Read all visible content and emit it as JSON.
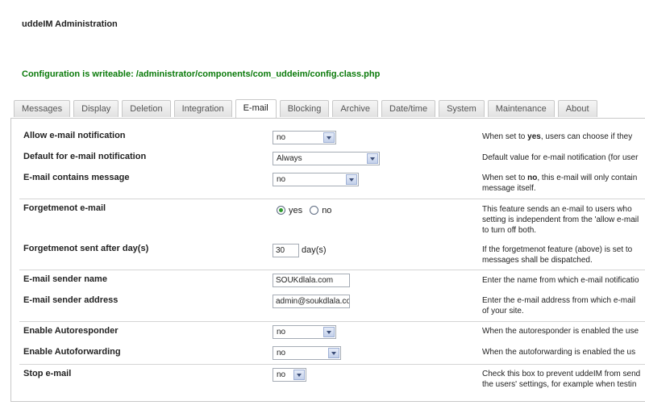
{
  "header": {
    "title": "uddeIM Administration",
    "status": "Configuration is writeable: /administrator/components/com_uddeim/config.class.php"
  },
  "tabs": [
    {
      "label": "Messages"
    },
    {
      "label": "Display"
    },
    {
      "label": "Deletion"
    },
    {
      "label": "Integration"
    },
    {
      "label": "E-mail",
      "active": true
    },
    {
      "label": "Blocking"
    },
    {
      "label": "Archive"
    },
    {
      "label": "Date/time"
    },
    {
      "label": "System"
    },
    {
      "label": "Maintenance"
    },
    {
      "label": "About"
    }
  ],
  "settings": {
    "allow_email": {
      "label": "Allow e-mail notification",
      "value": "no",
      "desc_pre": "When set to ",
      "desc_em": "yes",
      "desc_post": ", users can choose if they"
    },
    "default_email": {
      "label": "Default for e-mail notification",
      "value": "Always",
      "desc": "Default value for e-mail notification (for user"
    },
    "email_contains": {
      "label": "E-mail contains message",
      "value": "no",
      "desc_pre": "When set to ",
      "desc_em": "no",
      "desc_post": ", this e-mail will only contain",
      "desc_line2": "message itself."
    },
    "forgetmenot": {
      "label": "Forgetmenot e-mail",
      "option_yes": "yes",
      "option_no": "no",
      "desc_line1": "This feature sends an e-mail to users who",
      "desc_line2": "setting is independent from the 'allow e-mail",
      "desc_line3": "to turn off both."
    },
    "forgetmenot_days": {
      "label": "Forgetmenot sent after day(s)",
      "value": "30",
      "unit": "day(s)",
      "desc_line1": "If the forgetmenot feature (above) is set to",
      "desc_line2": "messages shall be dispatched."
    },
    "sender_name": {
      "label": "E-mail sender name",
      "value": "SOUKdlala.com",
      "desc": "Enter the name from which e-mail notificatio"
    },
    "sender_address": {
      "label": "E-mail sender address",
      "value": "admin@soukdlala.co",
      "desc_line1": "Enter the e-mail address from which e-mail",
      "desc_line2": "of your site."
    },
    "autoresponder": {
      "label": "Enable Autoresponder",
      "value": "no",
      "desc": "When the autoresponder is enabled the use"
    },
    "autoforwarding": {
      "label": "Enable Autoforwarding",
      "value": "no",
      "desc": "When the autoforwarding is enabled the us"
    },
    "stop_email": {
      "label": "Stop e-mail",
      "value": "no",
      "desc_line1": "Check this box to prevent uddeIM from send",
      "desc_line2": "the users' settings, for example when testin"
    }
  }
}
